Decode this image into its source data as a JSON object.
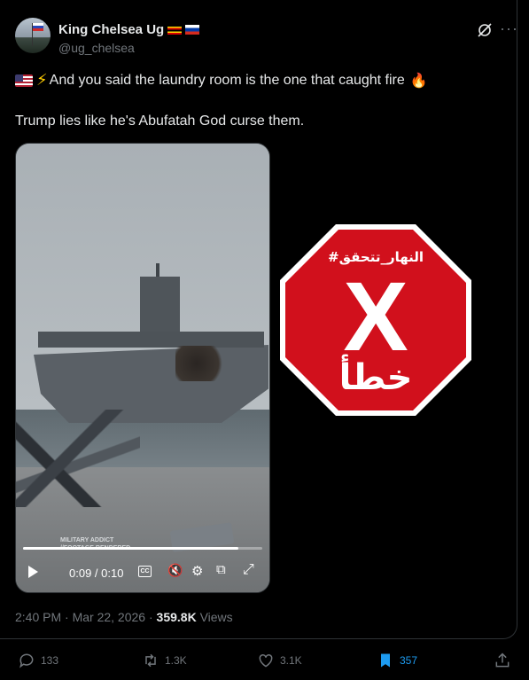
{
  "post": {
    "author_name": "King Chelsea Ug",
    "author_handle": "@ug_chelsea",
    "text_line1": "And you said the laundry room is the one that caught fire",
    "text_line2": "Trump lies like he's Abufatah God curse them.",
    "timestamp": "2:40 PM · Mar 22, 2026 ·",
    "views_count": "359.8K",
    "views_label": "Views"
  },
  "video": {
    "current_time": "0:09 / 0:10",
    "progress_fraction": 0.9,
    "watermark_line1": "MILITARY ADDICT",
    "watermark_line2": "//FOOTAGE RENDERED"
  },
  "fact_check": {
    "hashtag": "#النهار_تتحقق",
    "verdict_symbol": "X",
    "verdict_word": "خطأ",
    "color": "#d1101c"
  },
  "actions": {
    "replies": "133",
    "reposts": "1.3K",
    "likes": "3.1K",
    "bookmarks": "357",
    "bookmark_color": "#1d9bf0"
  },
  "icons": [
    "grok-icon",
    "more-icon",
    "play-icon",
    "captions-icon",
    "mute-icon",
    "settings-icon",
    "pip-icon",
    "fullscreen-icon",
    "reply-icon",
    "repost-icon",
    "like-icon",
    "bookmark-icon",
    "share-icon"
  ]
}
